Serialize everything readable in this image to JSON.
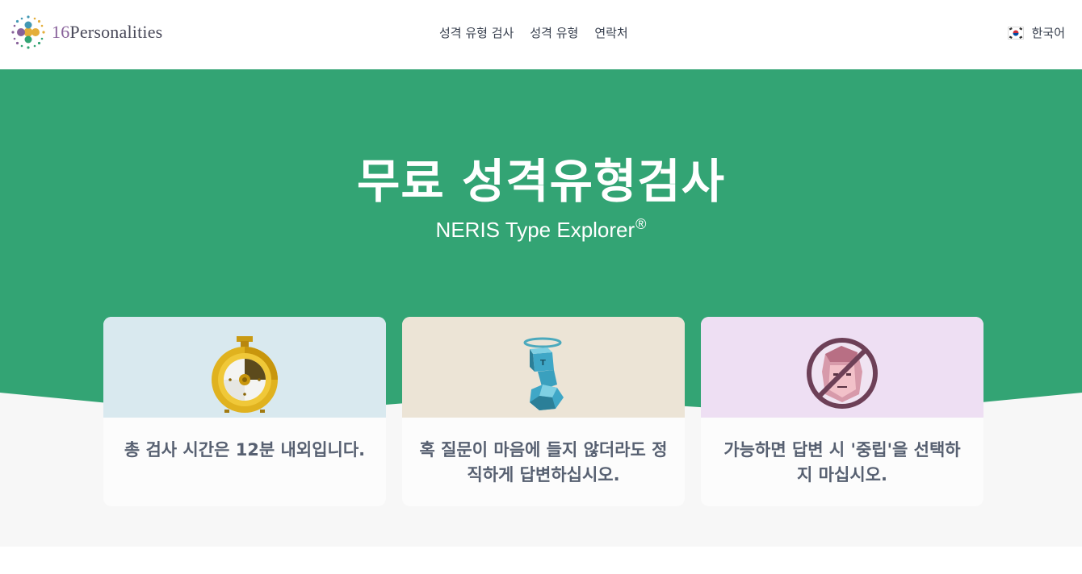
{
  "header": {
    "logo_number": "16",
    "logo_word": "Personalities",
    "nav": [
      {
        "label": "성격 유형 검사"
      },
      {
        "label": "성격 유형"
      },
      {
        "label": "연락처"
      }
    ],
    "language": "한국어"
  },
  "hero": {
    "title": "무료 성격유형검사",
    "subtitle": "NERIS Type Explorer",
    "registered": "®"
  },
  "cards": [
    {
      "icon": "stopwatch-icon",
      "text": "총 검사 시간은 12분 내외입니다.",
      "color": "#d9e9ef"
    },
    {
      "icon": "honest-angel-icon",
      "text": "혹 질문이 마음에 들지 않더라도 정직하게 답변하십시오.",
      "color": "#ece4d6"
    },
    {
      "icon": "no-neutral-face-icon",
      "text": "가능하면 답변 시 '중립'을 선택하지 마십시오.",
      "color": "#eedff3"
    }
  ],
  "colors": {
    "brand_green": "#33a474",
    "footer_bg": "#f7f7f7",
    "text_dark": "#343c4b",
    "text_card": "#576071"
  }
}
